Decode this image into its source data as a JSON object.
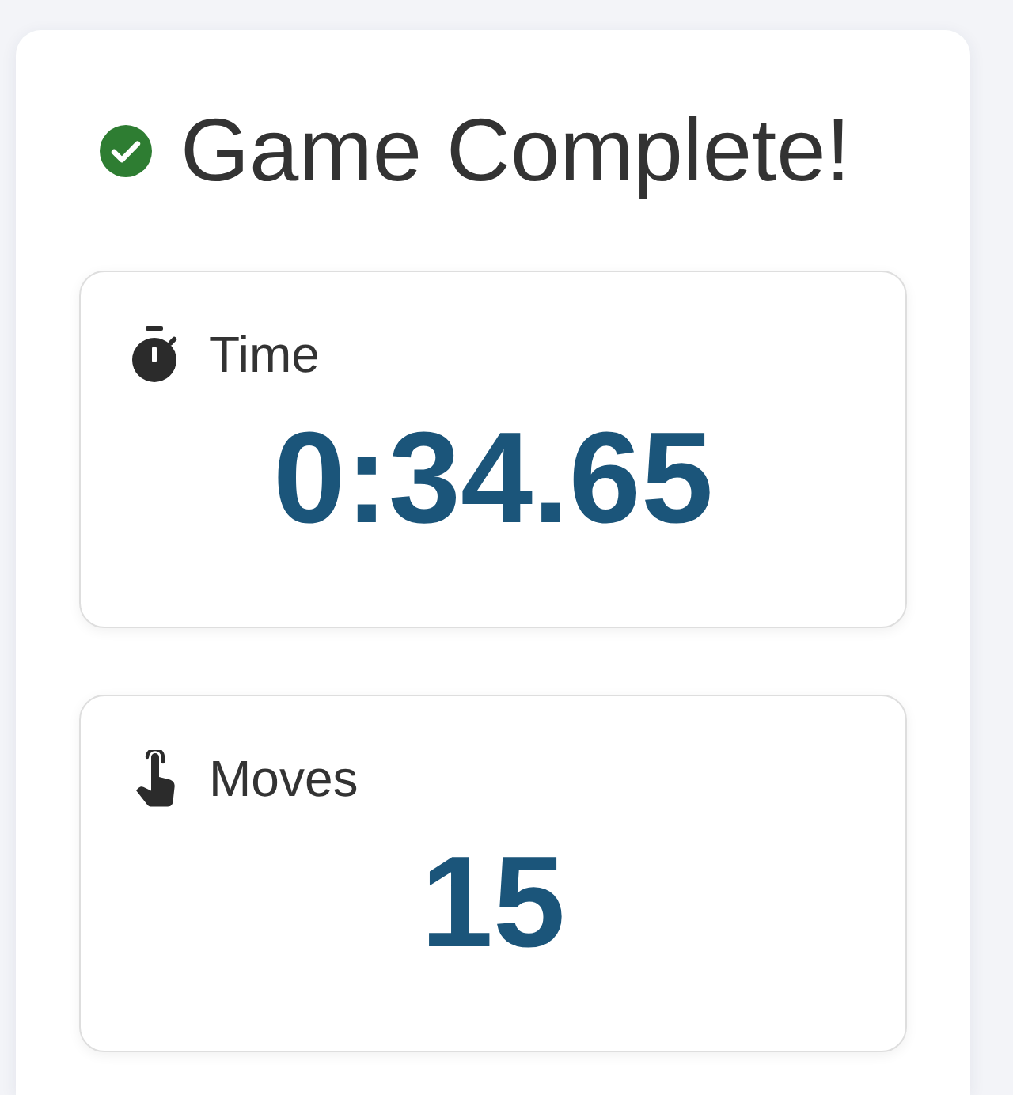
{
  "header": {
    "title": "Game Complete!"
  },
  "stats": [
    {
      "kind": "time",
      "label": "Time",
      "value": "0:34.65"
    },
    {
      "kind": "moves",
      "label": "Moves",
      "value": "15"
    }
  ]
}
